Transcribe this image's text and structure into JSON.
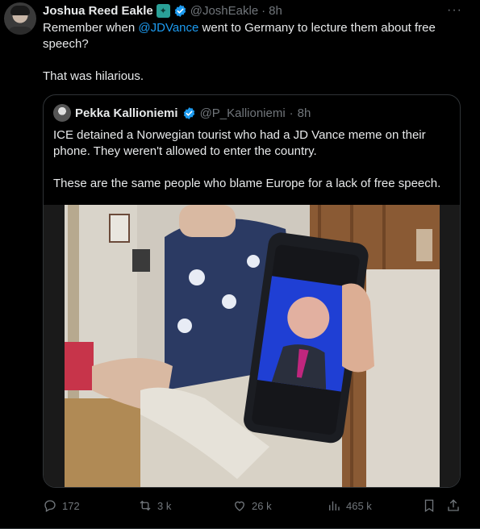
{
  "tweet": {
    "author": {
      "name": "Joshua Reed Eakle",
      "handle": "@JoshEakle",
      "time": "8h"
    },
    "dot": "·",
    "more_icon": "···",
    "text": {
      "line1_pre": "Remember when ",
      "mention": "@JDVance",
      "line1_post": " went to Germany to lecture them about free speech?",
      "line2": "That was hilarious."
    }
  },
  "quote": {
    "author": {
      "name": "Pekka Kallioniemi",
      "handle": "@P_Kallioniemi",
      "time": "8h"
    },
    "para1": "ICE detained a Norwegian tourist who had a JD Vance meme on their phone. They weren't allowed to enter the country.",
    "para2": "These are the same people who blame Europe for a lack of free speech."
  },
  "actions": {
    "replies": "172",
    "reposts": "3 k",
    "likes": "26 k",
    "views": "465 k"
  },
  "colors": {
    "accent": "#1d9bf0",
    "muted": "#71767b",
    "text": "#e7e9ea",
    "background": "#000000",
    "border": "#2f3336"
  }
}
